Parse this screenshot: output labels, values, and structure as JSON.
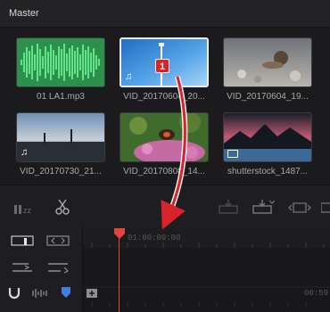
{
  "header": {
    "title": "Master"
  },
  "clips": [
    {
      "name": "01 LA1.mp3",
      "kind": "audio"
    },
    {
      "name": "VID_20170604_20...",
      "kind": "video",
      "selected": true
    },
    {
      "name": "VID_20170604_19...",
      "kind": "video"
    },
    {
      "name": "VID_20170730_21...",
      "kind": "video"
    },
    {
      "name": "VID_20170808_14...",
      "kind": "video"
    },
    {
      "name": "shutterstock_1487...",
      "kind": "video"
    }
  ],
  "toolbar": {
    "tools": [
      "sleep-mode-icon",
      "scissors-icon",
      "insert-clip-icon",
      "overwrite-clip-icon",
      "replace-clip-icon",
      "place-on-top-icon"
    ]
  },
  "timeline": {
    "timecode": "01:00:00:00",
    "end_timecode": "00:59",
    "tools": [
      "trim-mode-icon",
      "dynamic-trim-icon",
      "insert-edit-icon",
      "append-edit-icon",
      "snapping-icon",
      "audio-scrub-icon",
      "marker-icon",
      "add-track-icon"
    ]
  },
  "annotation": {
    "badge": "1"
  },
  "colors": {
    "accent_red": "#d8232a",
    "playhead": "#e4443c",
    "marker_blue": "#3f7fe0",
    "audio_wave": "#3ecf6d"
  }
}
